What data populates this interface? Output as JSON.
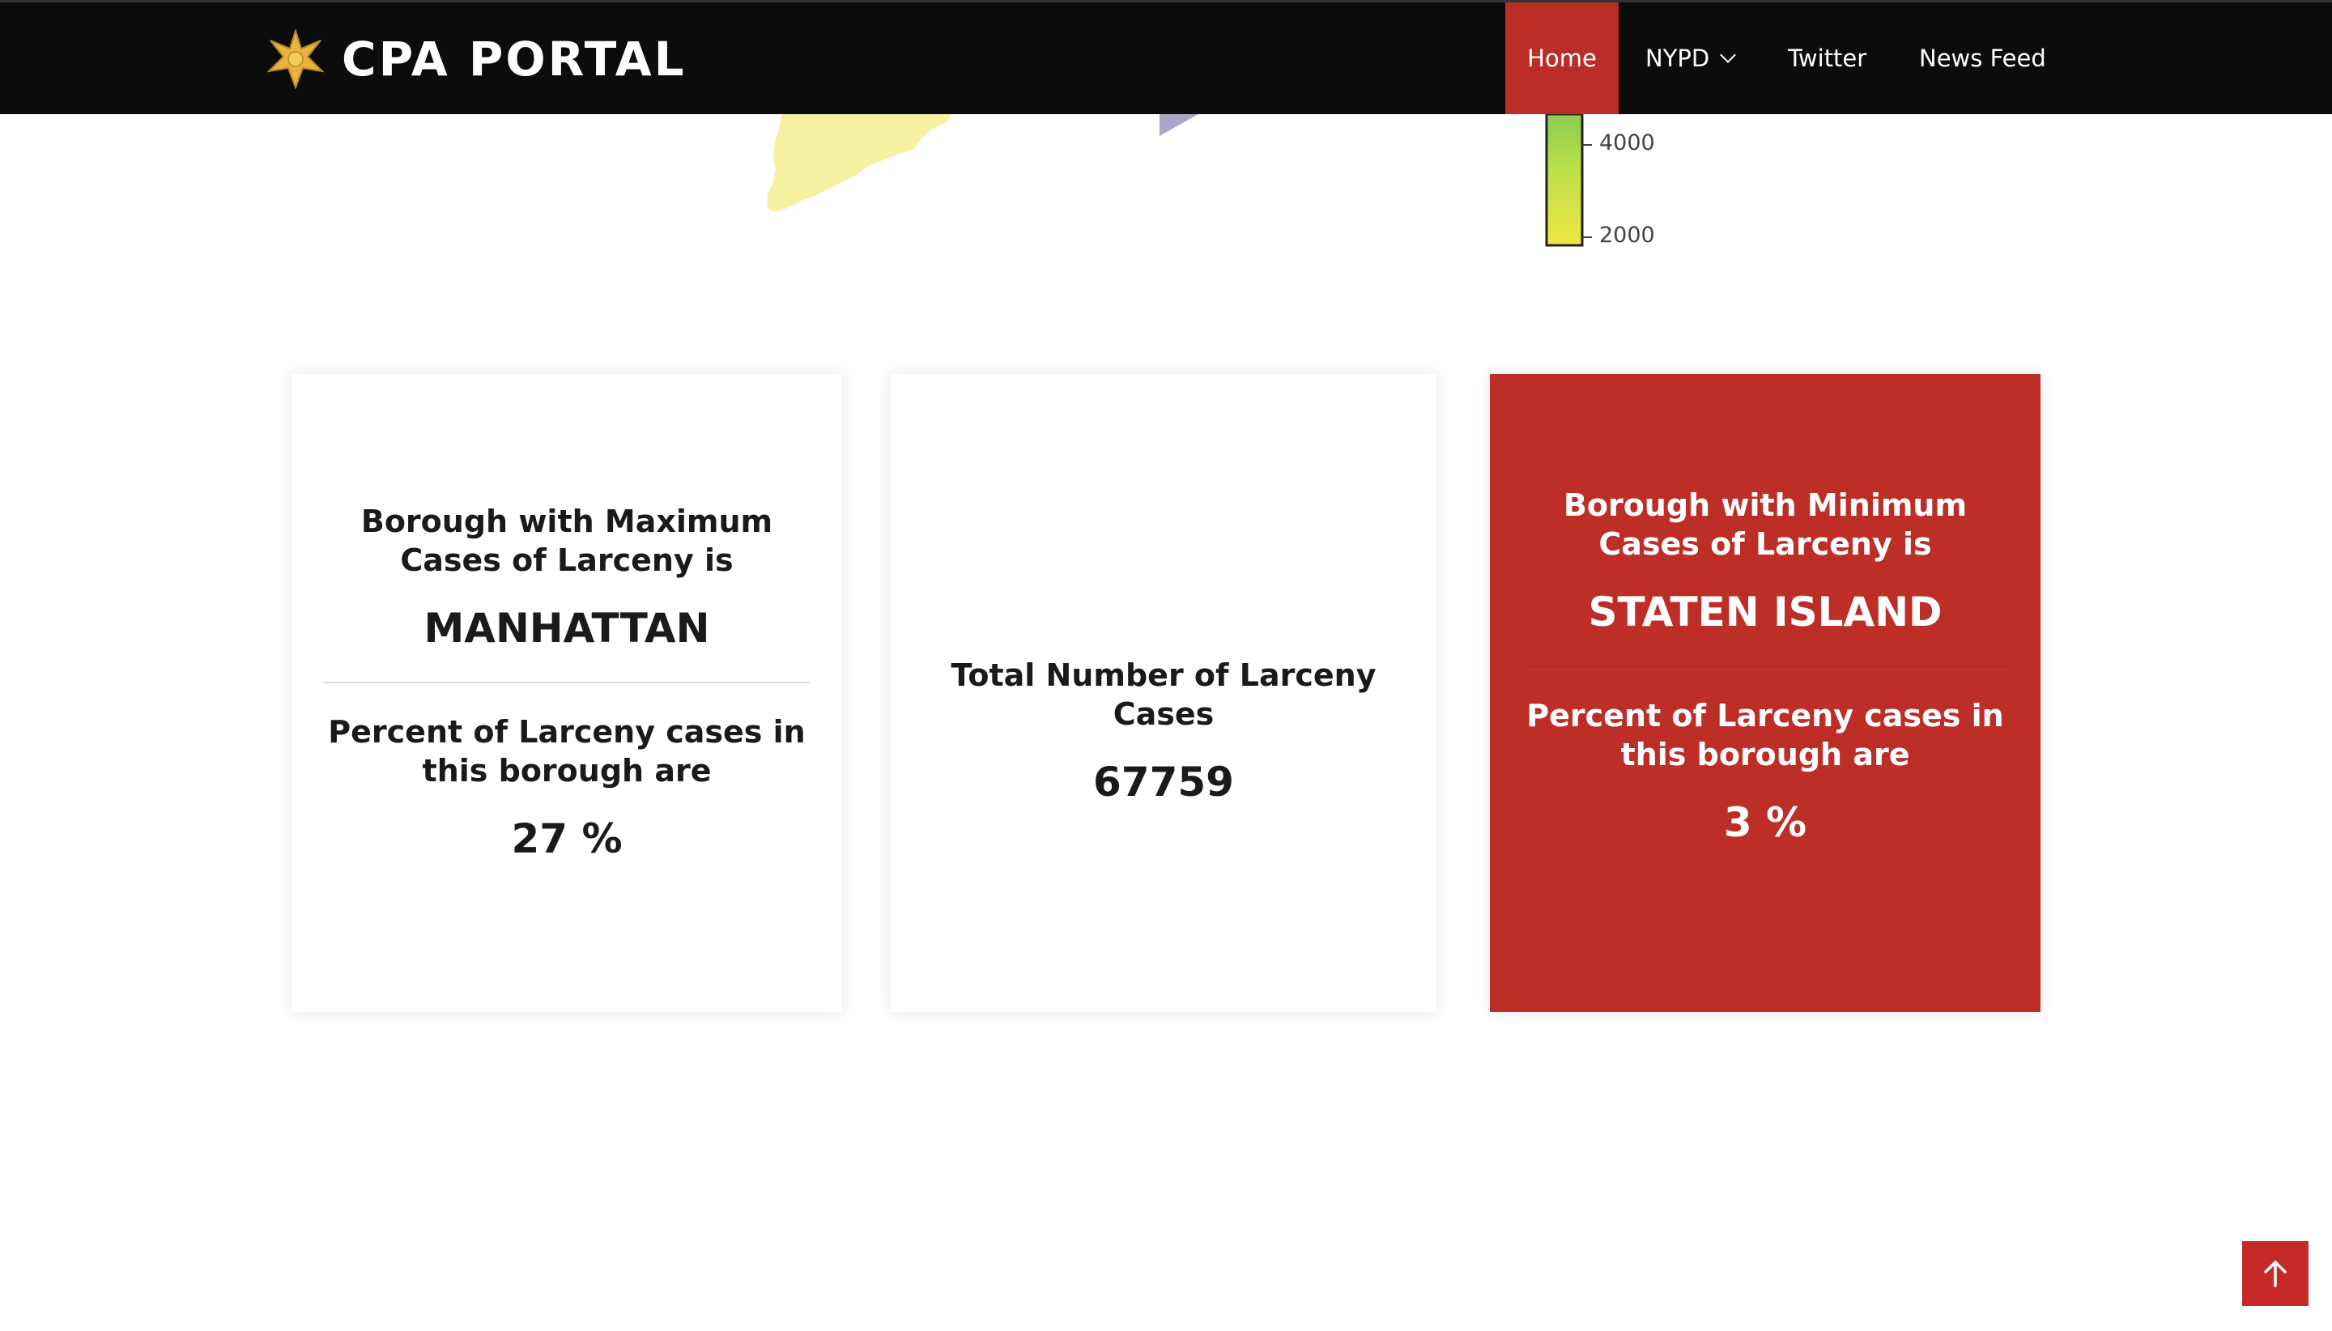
{
  "header": {
    "brand_title": "CPA PORTAL",
    "brand_icon": "star-badge-icon",
    "nav": [
      {
        "label": "Home",
        "active": true
      },
      {
        "label": "NYPD",
        "has_dropdown": true
      },
      {
        "label": "Twitter"
      },
      {
        "label": "News Feed"
      }
    ]
  },
  "map": {
    "colorbar_ticks": [
      "4000",
      "2000"
    ]
  },
  "cards": {
    "max": {
      "heading": "Borough with Maximum Cases of Larceny is",
      "borough": "MANHATTAN",
      "percent_heading": "Percent of Larceny cases in this borough are",
      "percent": "27 %"
    },
    "total": {
      "heading": "Total Number of Larceny Cases",
      "value": "67759"
    },
    "min": {
      "heading": "Borough with Minimum Cases of Larceny is",
      "borough": "STATEN ISLAND",
      "percent_heading": "Percent of Larceny cases in this borough are",
      "percent": "3 %"
    }
  },
  "back_to_top_icon": "arrow-up-icon",
  "colors": {
    "accent_red": "#bc2e26",
    "navbar_bg": "#0c0c0c"
  }
}
